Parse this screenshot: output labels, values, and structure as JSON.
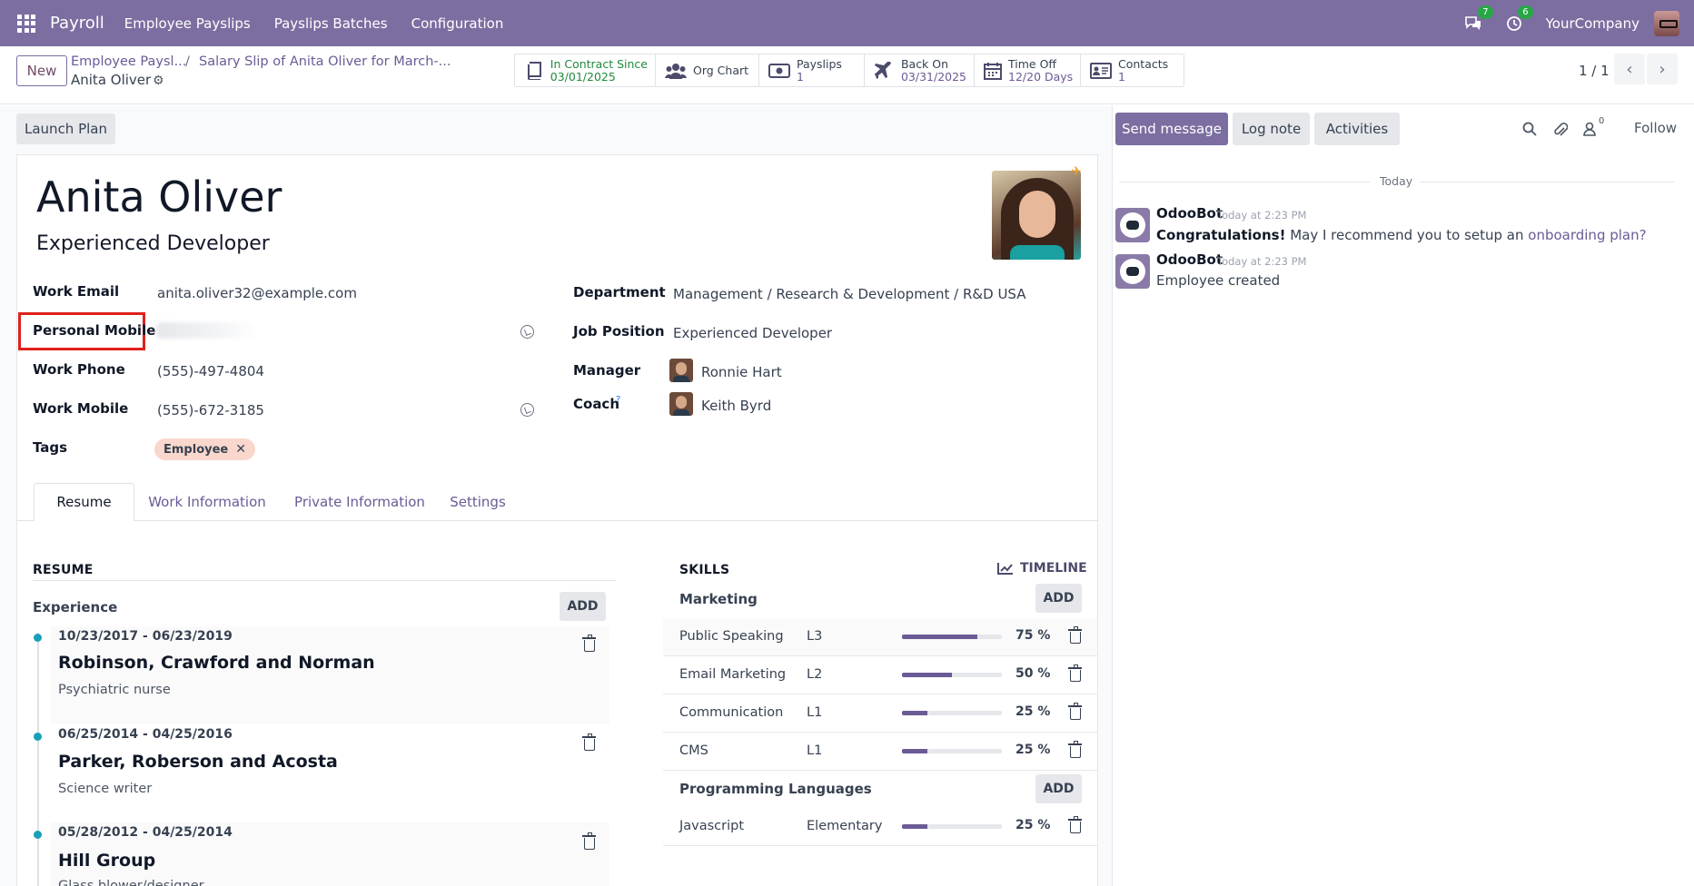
{
  "nav": {
    "brand": "Payroll",
    "menu": [
      "Employee Payslips",
      "Payslips Batches",
      "Configuration"
    ],
    "messages_badge": "7",
    "activities_badge": "6",
    "company": "YourCompany"
  },
  "control": {
    "new_label": "New",
    "breadcrumb_1": "Employee Paysl...",
    "breadcrumb_sep": "/",
    "breadcrumb_2": "Salary Slip of Anita Oliver for March-...",
    "current": "Anita Oliver",
    "smart_buttons": [
      {
        "title": "In Contract Since",
        "value": "03/01/2025",
        "icon": "book-icon"
      },
      {
        "title": "Org Chart",
        "value": "",
        "icon": "users-icon"
      },
      {
        "title": "Payslips",
        "value": "1",
        "icon": "money-icon"
      },
      {
        "title": "Back On",
        "value": "03/31/2025",
        "icon": "plane-icon"
      },
      {
        "title": "Time Off",
        "value": "12/20 Days",
        "icon": "calendar-icon"
      },
      {
        "title": "Contacts",
        "value": "1",
        "icon": "contact-card-icon"
      }
    ],
    "pager": "1 / 1"
  },
  "form": {
    "launch_plan": "Launch Plan",
    "name": "Anita Oliver",
    "job_title": "Experienced Developer",
    "left_fields": {
      "work_email_label": "Work Email",
      "work_email": "anita.oliver32@example.com",
      "personal_mobile_label": "Personal Mobile",
      "work_phone_label": "Work Phone",
      "work_phone": "(555)-497-4804",
      "work_mobile_label": "Work Mobile",
      "work_mobile": "(555)-672-3185",
      "tags_label": "Tags",
      "tag": "Employee"
    },
    "right_fields": {
      "department_label": "Department",
      "department": "Management / Research & Development / R&D USA",
      "job_position_label": "Job Position",
      "job_position": "Experienced Developer",
      "manager_label": "Manager",
      "manager": "Ronnie Hart",
      "coach_label": "Coach",
      "coach_help": "?",
      "coach": "Keith Byrd"
    },
    "tabs": [
      "Resume",
      "Work Information",
      "Private Information",
      "Settings"
    ]
  },
  "resume": {
    "title": "RESUME",
    "experience_label": "Experience",
    "add": "ADD",
    "entries": [
      {
        "dates": "10/23/2017 - 06/23/2019",
        "company": "Robinson, Crawford and Norman",
        "role": "Psychiatric nurse"
      },
      {
        "dates": "06/25/2014 - 04/25/2016",
        "company": "Parker, Roberson and Acosta",
        "role": "Science writer"
      },
      {
        "dates": "05/28/2012 - 04/25/2014",
        "company": "Hill Group",
        "role": "Glass blower/designer"
      }
    ]
  },
  "skills": {
    "title": "SKILLS",
    "timeline": "TIMELINE",
    "add": "ADD",
    "groups": [
      {
        "name": "Marketing",
        "items": [
          {
            "name": "Public Speaking",
            "level": "L3",
            "progress": 75,
            "pct": "75 %"
          },
          {
            "name": "Email Marketing",
            "level": "L2",
            "progress": 50,
            "pct": "50 %"
          },
          {
            "name": "Communication",
            "level": "L1",
            "progress": 25,
            "pct": "25 %"
          },
          {
            "name": "CMS",
            "level": "L1",
            "progress": 25,
            "pct": "25 %"
          }
        ]
      },
      {
        "name": "Programming Languages",
        "items": [
          {
            "name": "Javascript",
            "level": "Elementary",
            "progress": 25,
            "pct": "25 %"
          }
        ]
      }
    ]
  },
  "chatter": {
    "send_message": "Send message",
    "log_note": "Log note",
    "activities": "Activities",
    "followers_count": "0",
    "follow": "Follow",
    "day": "Today",
    "messages": [
      {
        "author": "OdooBot",
        "time": "Today at 2:23 PM",
        "bold": "Congratulations!",
        "text": " May I recommend you to setup an ",
        "link": "onboarding plan?"
      },
      {
        "author": "OdooBot",
        "time": "Today at 2:23 PM",
        "text": "Employee created"
      }
    ]
  }
}
